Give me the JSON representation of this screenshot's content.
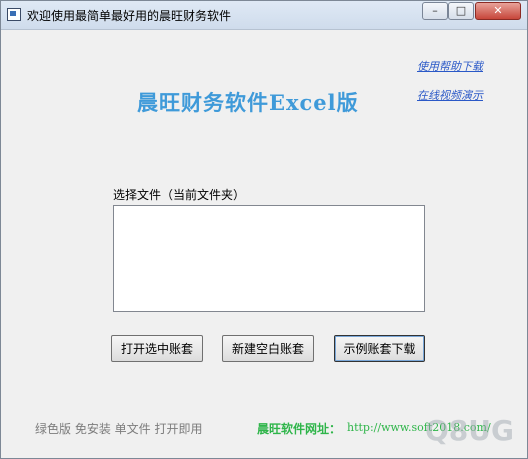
{
  "window": {
    "title": "欢迎使用最简单最好用的晨旺财务软件",
    "controls": {
      "minimize": "–",
      "maximize": "□",
      "close": "✕"
    }
  },
  "links": {
    "help_download": "使用帮助下载",
    "video_demo": "在线视频演示"
  },
  "main_title": "晨旺财务软件Excel版",
  "file_section": {
    "label": "选择文件（当前文件夹）",
    "items": []
  },
  "buttons": {
    "open_selected": "打开选中账套",
    "new_blank": "新建空白账套",
    "sample_download": "示例账套下载"
  },
  "footer": {
    "note": "绿色版 免安装  单文件 打开即用",
    "site_label": "晨旺软件网址：",
    "site_url": "http://www.soft2018.com/"
  },
  "colors": {
    "title_blue": "#3f9ad9",
    "link_blue": "#2a58c7",
    "site_green": "#2fb54a",
    "footer_gray": "#7c7c7c"
  }
}
